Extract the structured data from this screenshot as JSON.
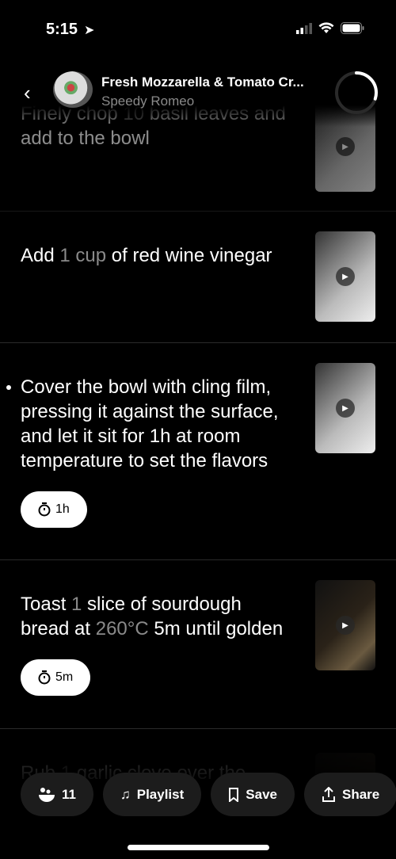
{
  "status": {
    "time": "5:15"
  },
  "header": {
    "title": "Fresh Mozzarella & Tomato Cr...",
    "subtitle": "Speedy Romeo",
    "progress": 0.3
  },
  "steps": [
    {
      "segments": [
        {
          "t": "Finely chop "
        },
        {
          "t": "10",
          "q": true
        },
        {
          "t": " basil leaves and add to the bowl"
        }
      ],
      "timer": null,
      "active": false
    },
    {
      "segments": [
        {
          "t": "Add "
        },
        {
          "t": "1 cup",
          "q": true
        },
        {
          "t": " of red wine vinegar"
        }
      ],
      "timer": null,
      "active": false
    },
    {
      "segments": [
        {
          "t": "Cover the bowl with cling film, pressing it against the surface, and let it sit for 1h at room temperature to set the flavors"
        }
      ],
      "timer": "1h",
      "active": true
    },
    {
      "segments": [
        {
          "t": "Toast "
        },
        {
          "t": "1",
          "q": true
        },
        {
          "t": " slice of sourdough bread at "
        },
        {
          "t": "260°C",
          "q": true
        },
        {
          "t": " 5m until golden"
        }
      ],
      "timer": "5m",
      "active": false
    },
    {
      "segments": [
        {
          "t": "Rub "
        },
        {
          "t": "1",
          "q": true
        },
        {
          "t": " garlic clove over the"
        }
      ],
      "timer": null,
      "active": false
    }
  ],
  "bottom_bar": {
    "ingredients_count": "11",
    "playlist": "Playlist",
    "save": "Save",
    "share": "Share"
  }
}
